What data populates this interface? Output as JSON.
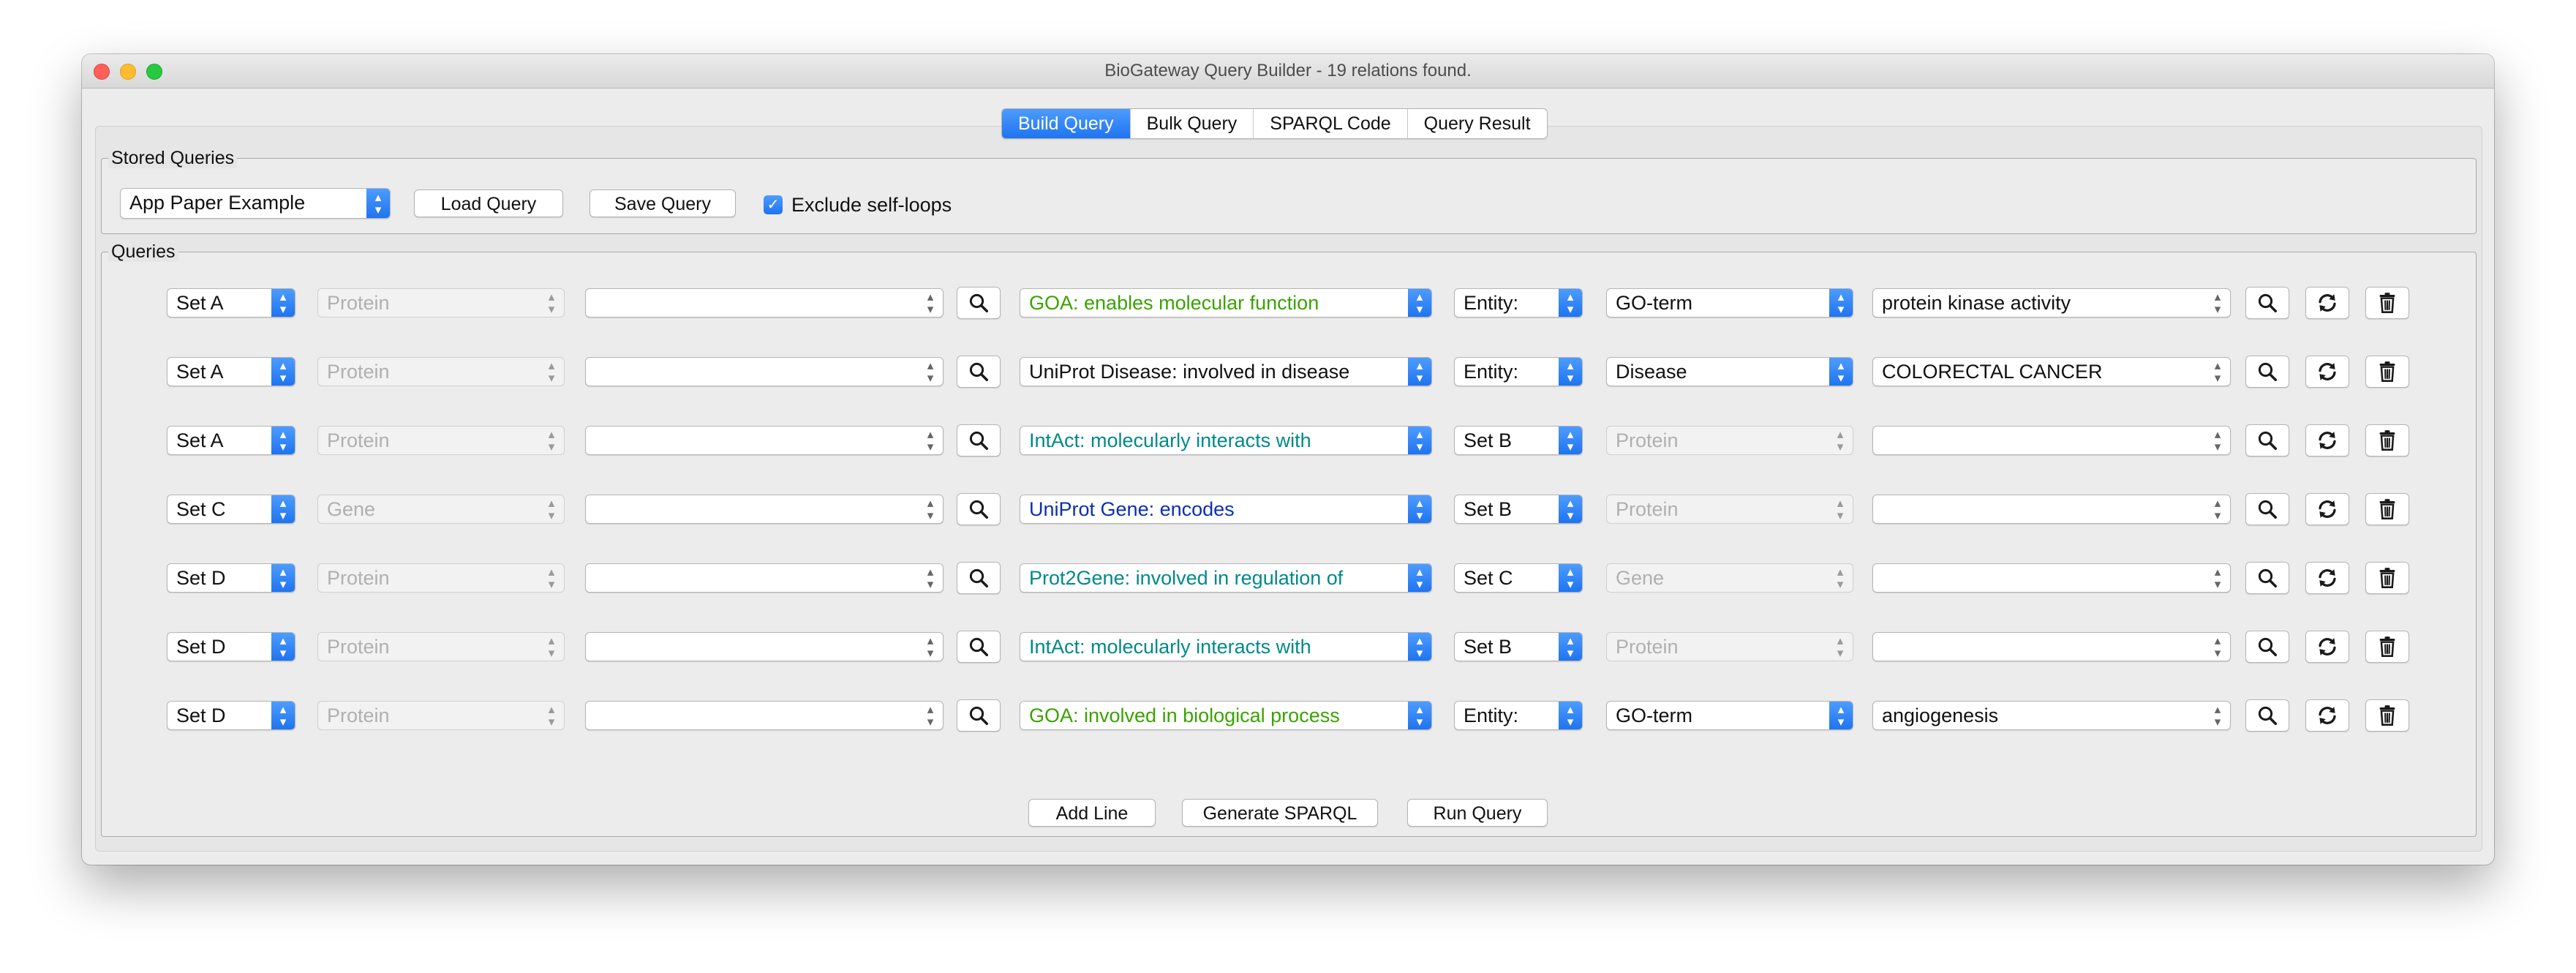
{
  "window": {
    "title": "BioGateway Query Builder - 19 relations found."
  },
  "tabs": [
    {
      "label": "Build Query",
      "active": true
    },
    {
      "label": "Bulk Query",
      "active": false
    },
    {
      "label": "SPARQL Code",
      "active": false
    },
    {
      "label": "Query Result",
      "active": false
    }
  ],
  "stored_queries": {
    "title": "Stored Queries",
    "selected": "App Paper Example",
    "load_label": "Load Query",
    "save_label": "Save Query",
    "exclude_self_loops": {
      "label": "Exclude self-loops",
      "checked": true
    }
  },
  "queries": {
    "title": "Queries",
    "rows": [
      {
        "subject_set": "Set A",
        "subject_type": "Protein",
        "subject_value": "",
        "relation": "GOA: enables molecular function",
        "relation_color": "#3aa300",
        "object_set": "Entity:",
        "object_type": "GO-term",
        "object_type_enabled": true,
        "object_value": "protein kinase activity"
      },
      {
        "subject_set": "Set A",
        "subject_type": "Protein",
        "subject_value": "",
        "relation": "UniProt Disease: involved in disease",
        "relation_color": "#111111",
        "object_set": "Entity:",
        "object_type": "Disease",
        "object_type_enabled": true,
        "object_value": "COLORECTAL CANCER"
      },
      {
        "subject_set": "Set A",
        "subject_type": "Protein",
        "subject_value": "",
        "relation": "IntAct: molecularly interacts with",
        "relation_color": "#00898a",
        "object_set": "Set B",
        "object_type": "Protein",
        "object_type_enabled": false,
        "object_value": ""
      },
      {
        "subject_set": "Set C",
        "subject_type": "Gene",
        "subject_value": "",
        "relation": "UniProt Gene: encodes",
        "relation_color": "#0b2fb0",
        "object_set": "Set B",
        "object_type": "Protein",
        "object_type_enabled": false,
        "object_value": ""
      },
      {
        "subject_set": "Set D",
        "subject_type": "Protein",
        "subject_value": "",
        "relation": "Prot2Gene: involved in regulation of",
        "relation_color": "#00898a",
        "object_set": "Set C",
        "object_type": "Gene",
        "object_type_enabled": false,
        "object_value": ""
      },
      {
        "subject_set": "Set D",
        "subject_type": "Protein",
        "subject_value": "",
        "relation": "IntAct: molecularly interacts with",
        "relation_color": "#00898a",
        "object_set": "Set B",
        "object_type": "Protein",
        "object_type_enabled": false,
        "object_value": ""
      },
      {
        "subject_set": "Set D",
        "subject_type": "Protein",
        "subject_value": "",
        "relation": "GOA: involved in biological process",
        "relation_color": "#3aa300",
        "object_set": "Entity:",
        "object_type": "GO-term",
        "object_type_enabled": true,
        "object_value": "angiogenesis"
      }
    ]
  },
  "footer": {
    "add_line_label": "Add Line",
    "generate_sparql_label": "Generate SPARQL",
    "run_query_label": "Run Query"
  },
  "icons": {
    "search": "search-icon",
    "refresh": "refresh-icon",
    "delete": "trash-icon"
  }
}
